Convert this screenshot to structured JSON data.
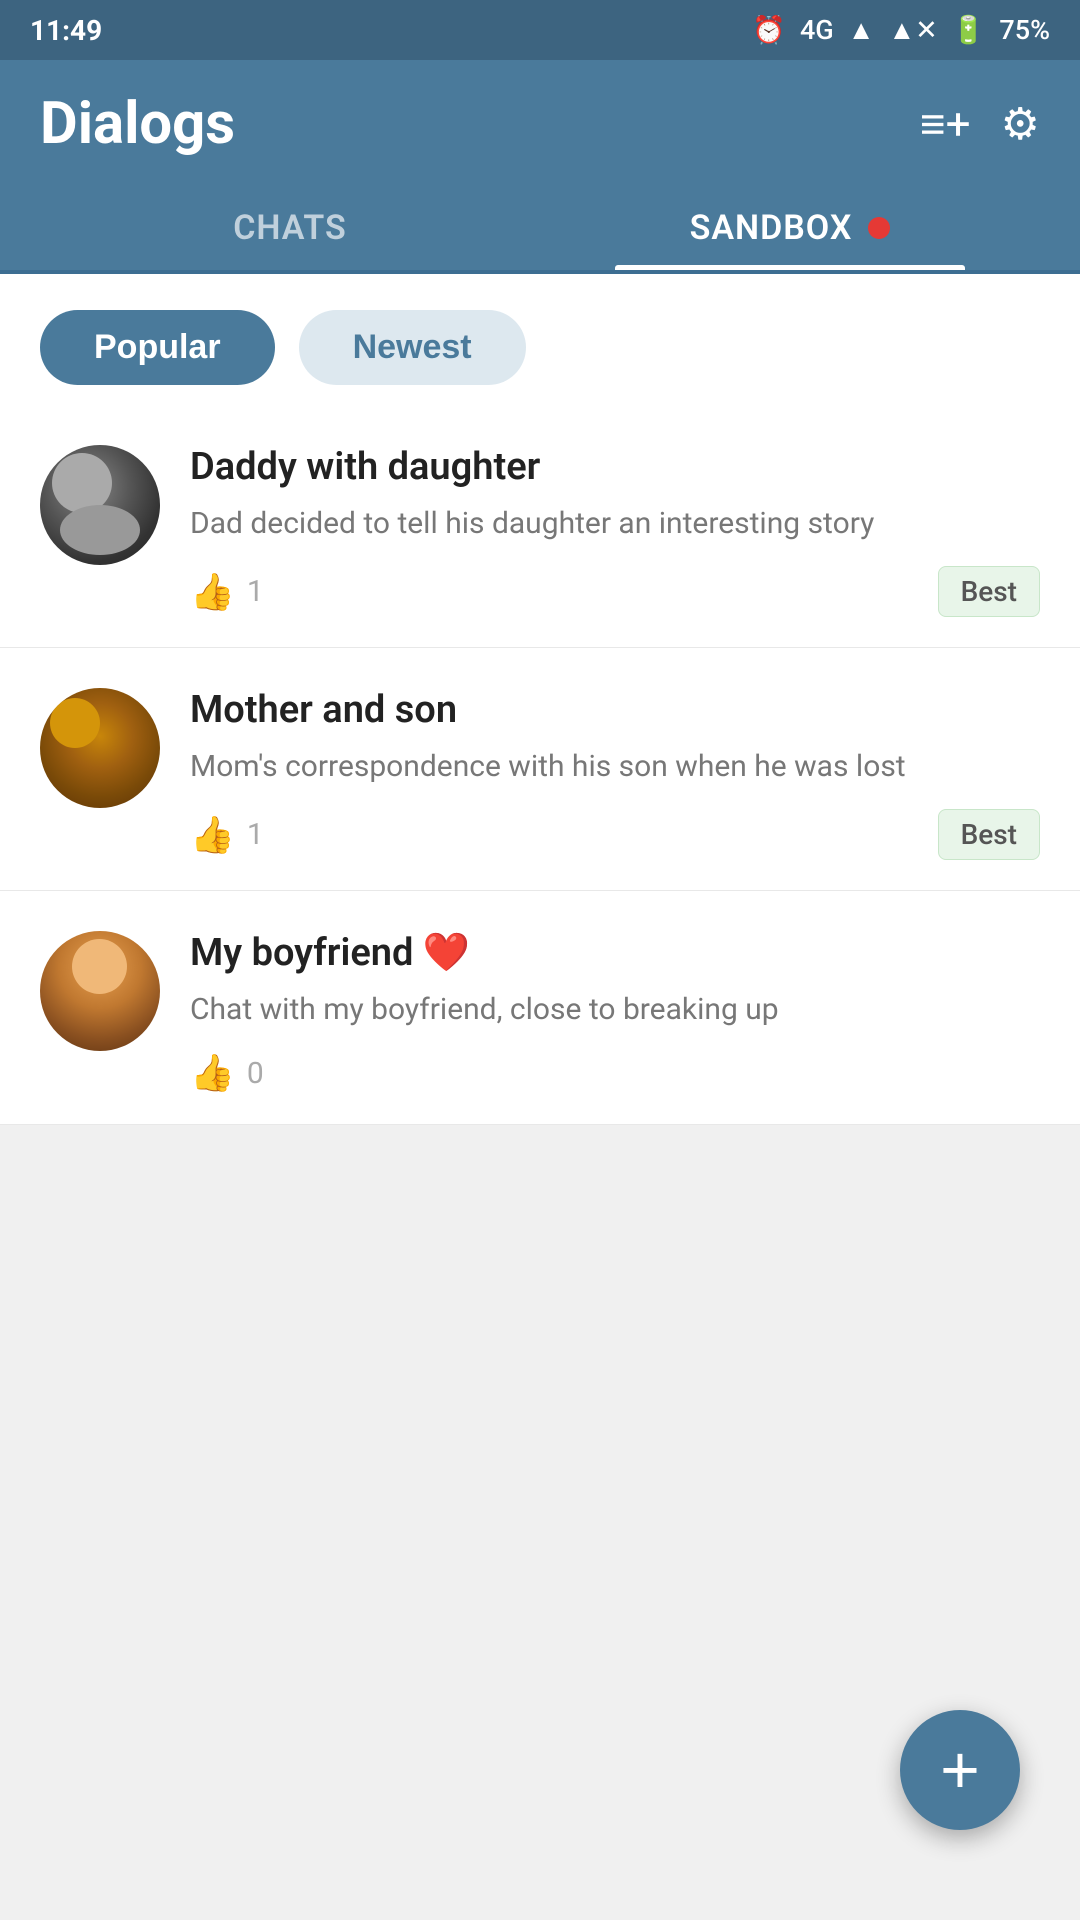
{
  "statusBar": {
    "time": "11:49",
    "network": "4G",
    "battery": "75%"
  },
  "header": {
    "title": "Dialogs",
    "newChatIcon": "≡+",
    "settingsIcon": "⚙"
  },
  "tabs": [
    {
      "id": "chats",
      "label": "CHATS",
      "active": false
    },
    {
      "id": "sandbox",
      "label": "SANDBOX",
      "active": true,
      "hasDot": true
    }
  ],
  "filters": [
    {
      "id": "popular",
      "label": "Popular",
      "active": true
    },
    {
      "id": "newest",
      "label": "Newest",
      "active": false
    }
  ],
  "chats": [
    {
      "id": 1,
      "title": "Daddy with daughter",
      "description": "Dad decided to tell his daughter an interesting story",
      "likes": 1,
      "badge": "Best",
      "hasHeart": false
    },
    {
      "id": 2,
      "title": "Mother and son",
      "description": "Mom's correspondence with his son when he was lost",
      "likes": 1,
      "badge": "Best",
      "hasHeart": false
    },
    {
      "id": 3,
      "title": "My boyfriend",
      "description": "Chat with my boyfriend, close to breaking up",
      "likes": 0,
      "badge": null,
      "hasHeart": true
    }
  ],
  "fab": {
    "label": "+"
  }
}
